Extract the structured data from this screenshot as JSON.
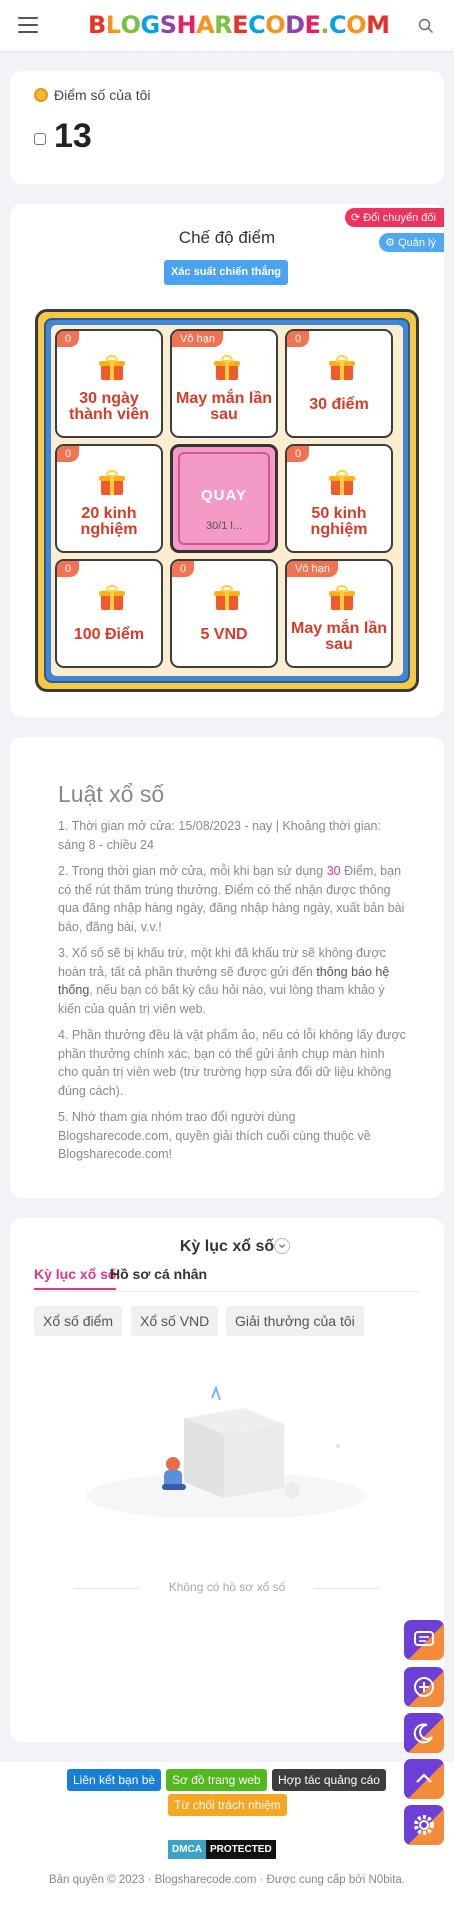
{
  "header": {
    "logo_text": "BLOGSHARECODE.COM",
    "logo_colors": [
      "#e6332a",
      "#f7941d",
      "#7ac142",
      "#00a2e8",
      "#8e44ad",
      "#e91e63",
      "#f7941d",
      "#7ac142",
      "#e6332a",
      "#00a2e8",
      "#f7941d",
      "#8e44ad",
      "#e91e63",
      "#7ac142",
      "#00a2e8",
      "#f7941d",
      "#e6332a"
    ]
  },
  "score": {
    "title": "Điểm số của tôi",
    "value": "13"
  },
  "lottery": {
    "mode_title": "Chế độ điểm",
    "exchange_label": "Đổi chuyển đổi",
    "manage_label": "Quản lý",
    "win_rate_label": "Xác suất chiến thắng",
    "spin_label": "QUAY",
    "spin_count": "30/1 l...",
    "prizes": [
      {
        "badge": "0",
        "label": "30 ngày thành viên"
      },
      {
        "badge": "Vô hạn",
        "label": "May mắn lần sau"
      },
      {
        "badge": "0",
        "label": "30 điểm"
      },
      {
        "badge": "0",
        "label": "20 kinh nghiệm"
      },
      {
        "badge": "0",
        "label": "50 kinh nghiệm"
      },
      {
        "badge": "0",
        "label": "100 Điểm"
      },
      {
        "badge": "0",
        "label": "5 VND"
      },
      {
        "badge": "Vô hạn",
        "label": "May mắn lần sau"
      }
    ]
  },
  "rules": {
    "title": "Luật xổ số",
    "r1": "1. Thời gian mở cửa: 15/08/2023 - nay  |  Khoảng thời gian: sáng 8 - chiều 24",
    "r2_a": "2. Trong thời gian mở cửa, mỗi khi bạn sử dụng ",
    "r2_hl": "30",
    "r2_b": " Điểm, bạn có thể rút thăm trúng thưởng. Điểm có thể nhận được thông qua đăng nhập hàng ngày, đăng nhập hàng ngày, xuất bản bài báo, đăng bài, v.v.!",
    "r3_a": "3. Xổ số sẽ bị khấu trừ, một khi đã khấu trừ sẽ không được hoàn trả, tất cả phần thưởng sẽ được gửi đến ",
    "r3_hl": "thông báo hệ thống",
    "r3_b": ", nếu bạn có bất kỳ câu hỏi nào, vui lòng tham khảo ý kiến của quản trị viên web.",
    "r4": "4. Phần thưởng đều là vật phẩm ảo, nếu có lỗi không lấy được phần thưởng chính xác, bạn có thể gửi ảnh chụp màn hình cho quản trị viên web (trừ trường hợp sửa đổi dữ liệu không đúng cách).",
    "r5": "5. Nhớ tham gia nhóm trao đổi người dùng Blogsharecode.com, quyền giải thích cuối cùng thuộc về Blogsharecode.com!"
  },
  "history": {
    "title": "Kỳ lục xổ số",
    "tab_active": "Kỳ lục xổ số",
    "tab_other": "Hồ sơ cá nhân",
    "chips": [
      "Xổ số điểm",
      "Xổ số VND",
      "Giải thưởng của tôi"
    ],
    "empty_text": "Không có hồ sơ xổ số"
  },
  "footer": {
    "links": [
      {
        "label": "Liên kết bạn bè",
        "color": "#1a7fd4"
      },
      {
        "label": "Sơ đồ trang web",
        "color": "#52b820"
      },
      {
        "label": "Hợp tác quảng cáo",
        "color": "#3d3d3d"
      },
      {
        "label": "Từ chối trách nhiệm",
        "color": "#f5a623"
      }
    ],
    "dmca_a": "DMCA",
    "dmca_b": "PROTECTED",
    "copyright": "Bản quyền © 2023 · Blogsharecode.com · Được cung cấp bởi N0bita."
  },
  "fabs": [
    "chat-icon",
    "add-icon",
    "moon-icon",
    "arrow-up-icon",
    "gear-icon"
  ]
}
